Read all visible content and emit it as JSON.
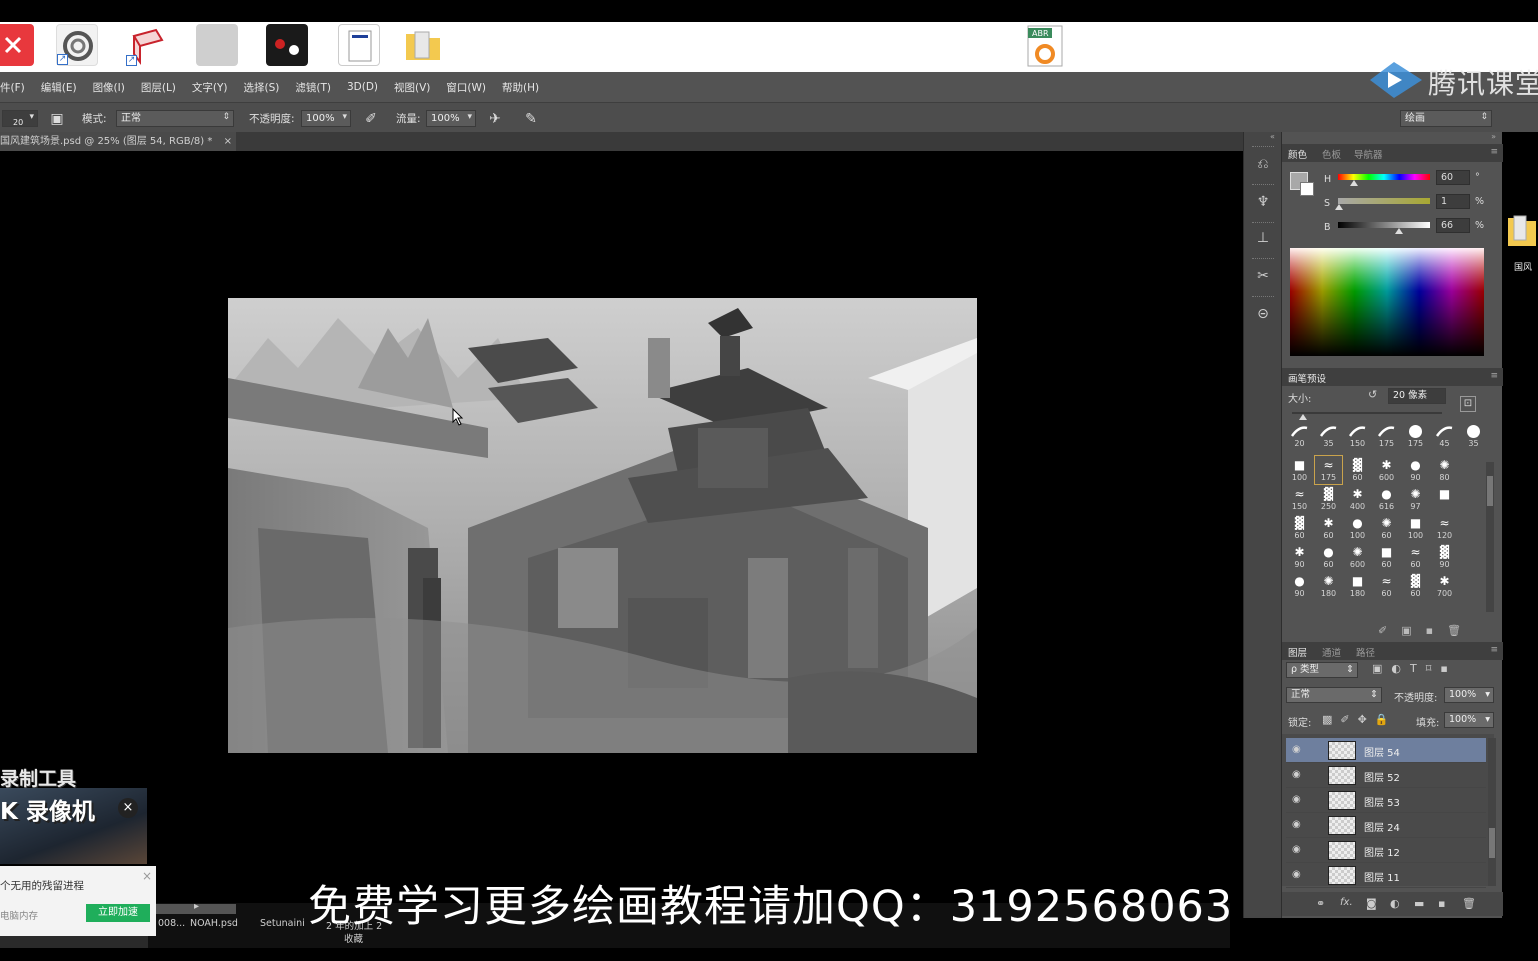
{
  "menu": [
    "件(F)",
    "编辑(E)",
    "图像(I)",
    "图层(L)",
    "文字(Y)",
    "选择(S)",
    "滤镜(T)",
    "3D(D)",
    "视图(V)",
    "窗口(W)",
    "帮助(H)"
  ],
  "watermark": {
    "text": "腾讯课堂"
  },
  "desktop": {
    "abr_label": "ABR",
    "side_icon_label": "国风"
  },
  "options_bar": {
    "brush_size": "20",
    "mode_label": "模式:",
    "mode_value": "正常",
    "opacity_label": "不透明度:",
    "opacity_value": "100%",
    "flow_label": "流量:",
    "flow_value": "100%",
    "workspace_value": "绘画"
  },
  "document": {
    "tab_title": "国风建筑场景.psd @ 25% (图层 54, RGB/8) *",
    "close_glyph": "×"
  },
  "color_panel": {
    "tabs": [
      "颜色",
      "色板",
      "导航器"
    ],
    "sliders": [
      {
        "label": "H",
        "value": "60",
        "unit": "°",
        "level": 0.17
      },
      {
        "label": "S",
        "value": "1",
        "unit": "%",
        "level": 0.01
      },
      {
        "label": "B",
        "value": "66",
        "unit": "%",
        "level": 0.66
      }
    ]
  },
  "brush_panel": {
    "tab": "画笔预设",
    "size_label": "大小:",
    "size_value": "20 像素",
    "presets_row": [
      "20",
      "35",
      "150",
      "175",
      "175",
      "45",
      "35"
    ],
    "grid": [
      [
        "100",
        "175",
        "60",
        "600",
        "90",
        "80"
      ],
      [
        "150",
        "250",
        "400",
        "616",
        "97",
        ""
      ],
      [
        "60",
        "60",
        "100",
        "60",
        "100",
        "120"
      ],
      [
        "90",
        "60",
        "600",
        "60",
        "60",
        "90"
      ],
      [
        "90",
        "180",
        "180",
        "60",
        "60",
        "700"
      ]
    ]
  },
  "layers_panel": {
    "tabs": [
      "图层",
      "通道",
      "路径"
    ],
    "filter_label": "ρ 类型",
    "blend_mode": "正常",
    "opacity_label": "不透明度:",
    "opacity_value": "100%",
    "lock_label": "锁定:",
    "fill_label": "填充:",
    "fill_value": "100%",
    "layers": [
      {
        "name": "图层 54",
        "selected": true
      },
      {
        "name": "图层 52",
        "selected": false
      },
      {
        "name": "图层 53",
        "selected": false
      },
      {
        "name": "图层 24",
        "selected": false
      },
      {
        "name": "图层 12",
        "selected": false
      },
      {
        "name": "图层 11",
        "selected": false
      }
    ],
    "footer_fx": "fx."
  },
  "promo": {
    "text": "免费学习更多绘画教程请加QQ：3192568063"
  },
  "recorder": {
    "title": "录制工具",
    "app_name": "K 录像机",
    "notice": "个无用的残留进程",
    "memory_label": "电脑内存",
    "speedup_button": "立即加速",
    "close_glyph": "×"
  },
  "taskbar": {
    "items": [
      "008...",
      "NOAH.psd",
      "Setunaini",
      "2 年的加上 2",
      "收藏"
    ]
  }
}
